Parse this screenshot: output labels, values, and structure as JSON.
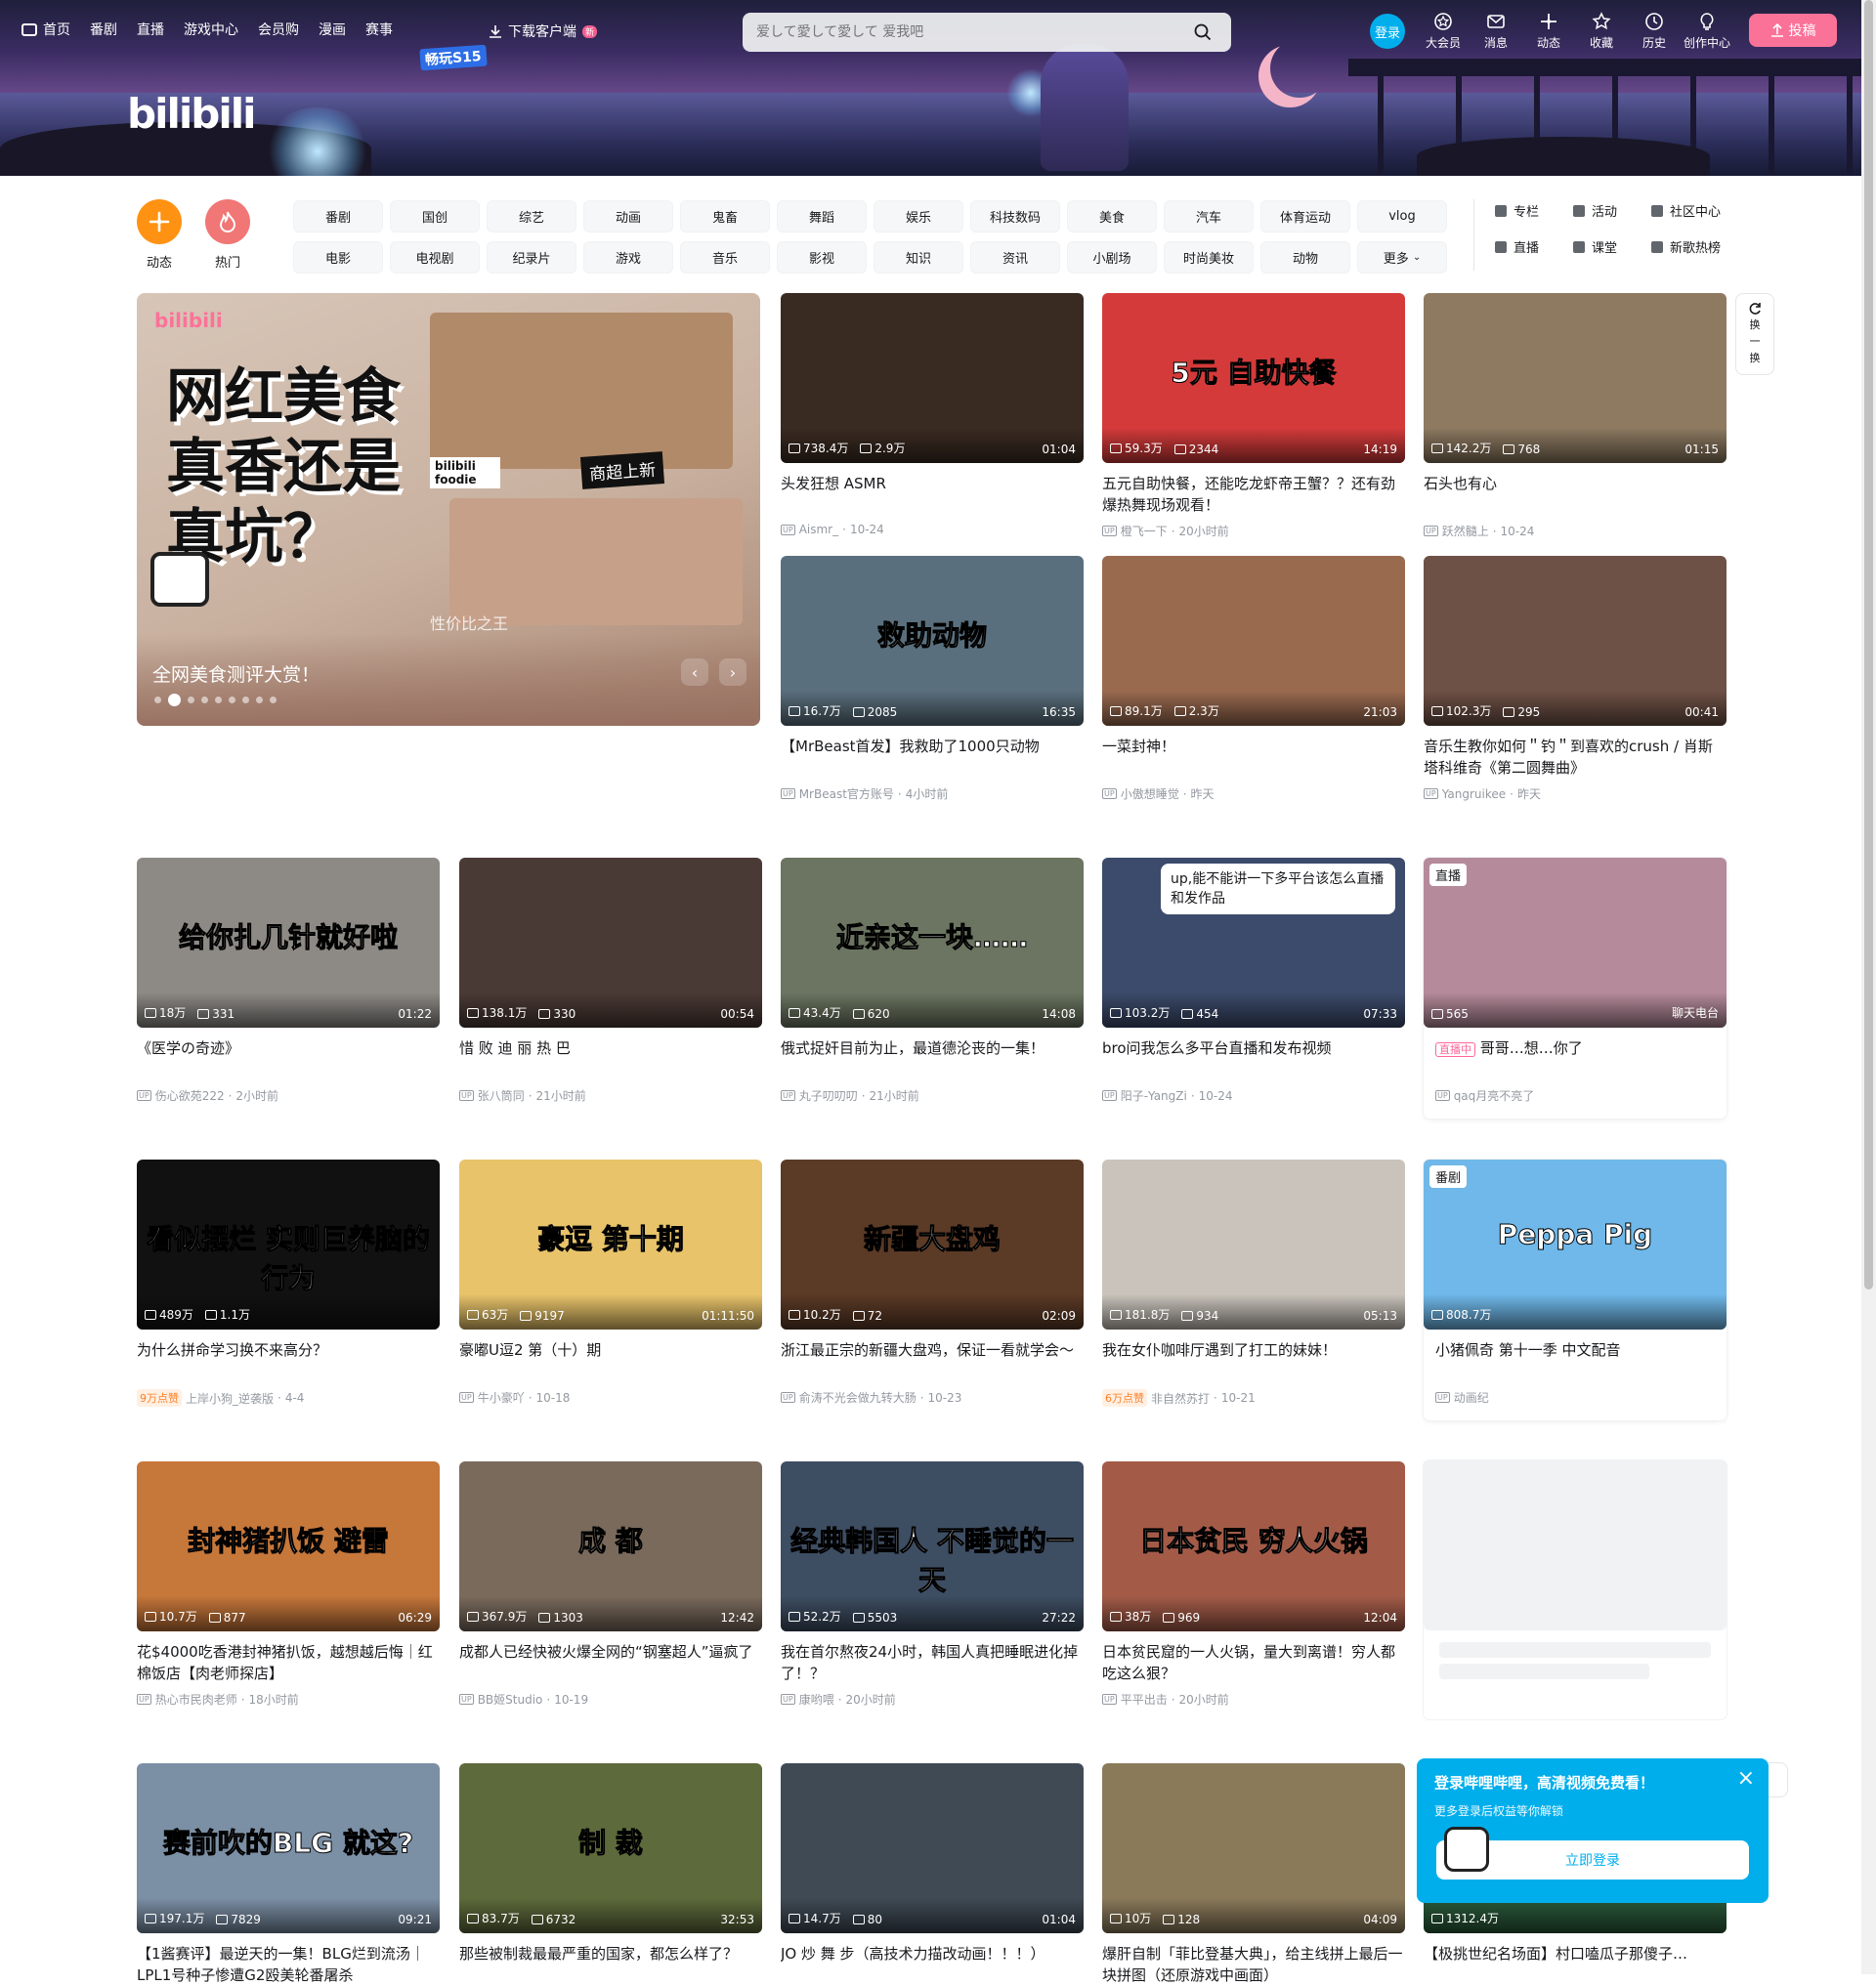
{
  "header": {
    "nav": [
      "首页",
      "番剧",
      "直播",
      "游戏中心",
      "会员购",
      "漫画",
      "赛事"
    ],
    "download": "下载客户端",
    "download_badge": "新",
    "search_placeholder": "爱して愛して愛して 爱我吧",
    "login": "登录",
    "right_icons": [
      {
        "label": "大会员",
        "icon": "vip-icon"
      },
      {
        "label": "消息",
        "icon": "message-icon"
      },
      {
        "label": "动态",
        "icon": "dynamic-icon"
      },
      {
        "label": "收藏",
        "icon": "star-icon"
      },
      {
        "label": "历史",
        "icon": "history-icon"
      },
      {
        "label": "创作中心",
        "icon": "creator-icon"
      }
    ],
    "upload": "投稿",
    "logo": "bilibili",
    "event_logo": "畅玩S15"
  },
  "channels": {
    "round": [
      {
        "label": "动态",
        "color": "#ff9212"
      },
      {
        "label": "热门",
        "color": "#f07775"
      }
    ],
    "grid": [
      "番剧",
      "国创",
      "综艺",
      "动画",
      "鬼畜",
      "舞蹈",
      "娱乐",
      "科技数码",
      "美食",
      "汽车",
      "体育运动",
      "vlog",
      "电影",
      "电视剧",
      "纪录片",
      "游戏",
      "音乐",
      "影视",
      "知识",
      "资讯",
      "小剧场",
      "时尚美妆",
      "动物",
      "更多"
    ],
    "links": [
      "专栏",
      "活动",
      "社区中心",
      "直播",
      "课堂",
      "新歌热榜"
    ]
  },
  "carousel": {
    "headline_lines": [
      "网红美食",
      "真香还是",
      "真坑？"
    ],
    "logo": "bilibili",
    "sub": "bilibili foodie",
    "tags": [
      "商超上新",
      "性价比之王"
    ],
    "title": "全网美食测评大赏！",
    "dots": 9,
    "active_dot": 1
  },
  "refresh": {
    "icon": "refresh-icon",
    "chars": [
      "换",
      "一",
      "换"
    ]
  },
  "cards": [
    {
      "views": "738.4万",
      "danmaku": "2.9万",
      "dur": "01:04",
      "title": "头发狂想 ASMR",
      "author": "Aismr_",
      "date": "10-24",
      "bg": "#3a2b22"
    },
    {
      "views": "59.3万",
      "danmaku": "2344",
      "dur": "14:19",
      "title": "五元自助快餐，还能吃龙虾帝王蟹？？还有劲爆热舞现场观看！",
      "author": "橙飞一下",
      "date": "20小时前",
      "bg": "#d43a3a",
      "ovt": "5元 自助快餐"
    },
    {
      "views": "142.2万",
      "danmaku": "768",
      "dur": "01:15",
      "title": "石头也有心",
      "author": "跃然髓上",
      "date": "10-24",
      "bg": "#8d7a61"
    },
    {
      "views": "16.7万",
      "danmaku": "2085",
      "dur": "16:35",
      "title": "【MrBeast首发】我救助了1000只动物",
      "author": "MrBeast官方账号",
      "date": "4小时前",
      "bg": "#5a6f7d",
      "ovt": "救助动物"
    },
    {
      "views": "89.1万",
      "danmaku": "2.3万",
      "dur": "21:03",
      "title": "一菜封神！",
      "author": "小傲想睡觉",
      "date": "昨天",
      "bg": "#9a6a4f"
    },
    {
      "views": "102.3万",
      "danmaku": "295",
      "dur": "00:41",
      "title": "音乐生教你如何＂钓＂到喜欢的crush / 肖斯塔科维奇《第二圆舞曲》",
      "author": "Yangruikee",
      "date": "昨天",
      "bg": "#6e5146"
    },
    {
      "views": "18万",
      "danmaku": "331",
      "dur": "01:22",
      "title": "《医学の奇迹》",
      "author": "伤心欲苑222",
      "date": "2小时前",
      "bg": "#8d8a85",
      "ovt": "给你扎几针就好啦"
    },
    {
      "views": "138.1万",
      "danmaku": "330",
      "dur": "00:54",
      "title": "惜 败 迪 丽 热 巴",
      "author": "张八筒同",
      "date": "21小时前",
      "bg": "#4a3a35"
    },
    {
      "views": "43.4万",
      "danmaku": "620",
      "dur": "14:08",
      "title": "俄式捉奸目前为止，最道德沦丧的一集！",
      "author": "丸子叨叨叨",
      "date": "21小时前",
      "bg": "#6b7561",
      "ovt": "近亲这一块……"
    },
    {
      "views": "103.2万",
      "danmaku": "454",
      "dur": "07:33",
      "title": "bro问我怎么多平台直播和发布视频",
      "author": "阳子-YangZi",
      "date": "10-24",
      "bg": "#3c4b6b",
      "bubble": "up,能不能讲一下多平台该怎么直播和发作品"
    },
    {
      "views": "565",
      "danmaku": "",
      "dur": "聊天电台",
      "title": "哥哥…想…你了",
      "author": "qaq月亮不亮了",
      "date": "",
      "bg": "#b58a9a",
      "badge": "直播",
      "live": "直播中",
      "boxed": true
    },
    {
      "views": "489万",
      "danmaku": "1.1万",
      "dur": "",
      "title": "为什么拼命学习换不来高分？",
      "author": "上岸小狗_逆袭版",
      "date": "4-4",
      "bg": "#111111",
      "ovt": "看似摆烂 实则巨养脑的行为",
      "hot": "9万点赞"
    },
    {
      "views": "63万",
      "danmaku": "9197",
      "dur": "01:11:50",
      "title": "豪嘟U逗2 第（十）期",
      "author": "牛小豪吖",
      "date": "10-18",
      "bg": "#e8c36a",
      "ovt": "豪逗 第十期"
    },
    {
      "views": "10.2万",
      "danmaku": "72",
      "dur": "02:09",
      "title": "浙江最正宗的新疆大盘鸡，保证一看就学会～",
      "author": "俞涛不光会做九转大肠",
      "date": "10-23",
      "bg": "#5b3a26",
      "ovt": "新疆大盘鸡"
    },
    {
      "views": "181.8万",
      "danmaku": "934",
      "dur": "05:13",
      "title": "我在女仆咖啡厅遇到了打工的妹妹！",
      "author": "非自然苏打",
      "date": "10-21",
      "bg": "#c9c3bb",
      "hot": "6万点赞"
    },
    {
      "views": "808.7万",
      "danmaku": "",
      "dur": "",
      "title": "小猪佩奇 第十一季 中文配音",
      "author": "动画纪",
      "date": "",
      "bg": "#6fb8e9",
      "badge": "番剧",
      "boxed": true,
      "ovt": "Peppa Pig"
    },
    {
      "views": "10.7万",
      "danmaku": "877",
      "dur": "06:29",
      "title": "花$4000吃香港封神猪扒饭，越想越后悔｜红棉饭店【肉老师探店】",
      "author": "热心市民肉老师",
      "date": "18小时前",
      "bg": "#c6773a",
      "ovt": "封神猪扒饭 避雷"
    },
    {
      "views": "367.9万",
      "danmaku": "1303",
      "dur": "12:42",
      "title": "成都人已经快被火爆全网的“钢塞超人”逼疯了",
      "author": "BB姬Studio",
      "date": "10-19",
      "bg": "#7a6a5c",
      "ovt": "成 都"
    },
    {
      "views": "52.2万",
      "danmaku": "5503",
      "dur": "27:22",
      "title": "我在首尔熬夜24小时，韩国人真把睡眠进化掉了！？",
      "author": "康哟喂",
      "date": "20小时前",
      "bg": "#3d4d62",
      "ovt": "经典韩国人 不睡觉的一天"
    },
    {
      "views": "38万",
      "danmaku": "969",
      "dur": "12:04",
      "title": "日本贫民窟的一人火锅，量大到离谱！穷人都吃这么狠？",
      "author": "平平出击",
      "date": "20小时前",
      "bg": "#a35b48",
      "ovt": "日本贫民  穷人火锅"
    },
    {
      "views": "197.1万",
      "danmaku": "7829",
      "dur": "09:21",
      "title": "【1酱赛评】最逆天的一集！BLG烂到流汤｜LPL1号种子惨遭G2殴美轮番屠杀",
      "author": "",
      "date": "",
      "bg": "#7b8fa5",
      "ovt": "赛前吹的BLG 就这?"
    },
    {
      "views": "83.7万",
      "danmaku": "6732",
      "dur": "32:53",
      "title": "那些被制裁最最严重的国家，都怎么样了？",
      "author": "",
      "date": "",
      "bg": "#5d6a3b",
      "ovt": "制  裁"
    },
    {
      "views": "14.7万",
      "danmaku": "80",
      "dur": "01:04",
      "title": "JO 炒 舞 步（高技术力描改动画！！！）",
      "author": "",
      "date": "",
      "bg": "#3f4a55"
    },
    {
      "views": "10万",
      "danmaku": "128",
      "dur": "04:09",
      "title": "爆肝自制「菲比登基大典」，给主线拼上最后一块拼图（还原游戏中画面）",
      "author": "",
      "date": "",
      "bg": "#8a7a5a"
    },
    {
      "views": "1312.4万",
      "danmaku": "",
      "dur": "",
      "title": "【极挑世纪名场面】村口嗑瓜子那傻子…",
      "author": "",
      "date": "",
      "bg": "#2a5a3a"
    }
  ],
  "popup": {
    "title": "登录哔哩哔哩，高清视频免费看！",
    "sub": "更多登录后权益等你解锁",
    "button": "立即登录",
    "close": "×"
  }
}
